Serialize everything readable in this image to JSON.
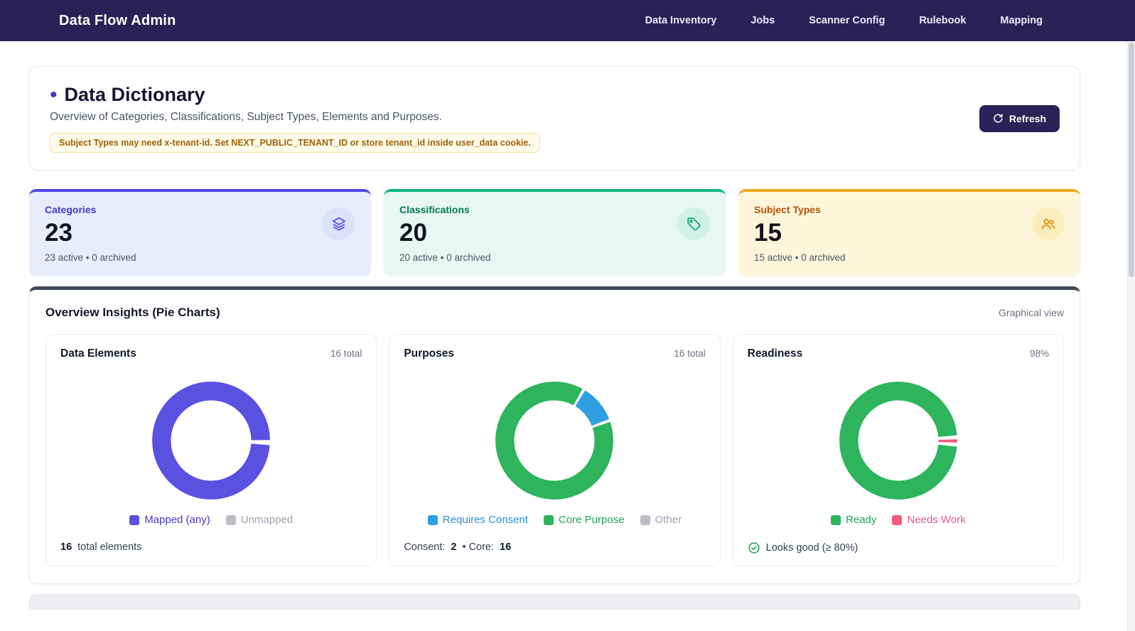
{
  "colors": {
    "navbar_bg": "#2a2156",
    "accent_indigo": "#4f46e5",
    "accent_teal": "#10b981",
    "accent_amber": "#f0a820",
    "insights_top_border": "#414a57",
    "notice_text": "#a16207",
    "refresh_button_bg": "#2a2357"
  },
  "navbar": {
    "brand": "Data Flow Admin",
    "items": [
      {
        "label": "Data Inventory"
      },
      {
        "label": "Jobs"
      },
      {
        "label": "Scanner Config"
      },
      {
        "label": "Rulebook"
      },
      {
        "label": "Mapping"
      }
    ]
  },
  "header": {
    "bullet": "•",
    "title": "Data Dictionary",
    "subtitle": "Overview of Categories, Classifications, Subject Types, Elements and Purposes.",
    "notice": "Subject Types may need x-tenant-id. Set NEXT_PUBLIC_TENANT_ID or store tenant_id inside user_data cookie.",
    "refresh_label": "Refresh"
  },
  "stats": [
    {
      "title": "Categories",
      "value": "23",
      "detail": "23 active • 0 archived",
      "icon": "layers-icon"
    },
    {
      "title": "Classifications",
      "value": "20",
      "detail": "20 active • 0 archived",
      "icon": "tag-icon"
    },
    {
      "title": "Subject Types",
      "value": "15",
      "detail": "15 active • 0 archived",
      "icon": "users-icon"
    }
  ],
  "insights": {
    "title": "Overview Insights (Pie Charts)",
    "view_label": "Graphical view"
  },
  "chart_data": [
    {
      "type": "pie",
      "title": "Data Elements",
      "total_label": "16 total",
      "segments": [
        {
          "label": "Mapped (any)",
          "value": 16,
          "color": "#5b51e1"
        },
        {
          "label": "Unmapped",
          "value": 0,
          "color": "#c7cbd4"
        }
      ],
      "legend": [
        {
          "label": "Mapped (any)",
          "swatch": "#5b51e1",
          "text_color": "#4338ca"
        },
        {
          "label": "Unmapped",
          "swatch": "#b9bec7",
          "text_color": "#9ca3af"
        }
      ],
      "footer": [
        {
          "text": "16",
          "bold": true
        },
        {
          "text": " total elements"
        }
      ],
      "layout": {
        "rotation": 92,
        "pad": 5,
        "legend_position": "bottom"
      }
    },
    {
      "type": "pie",
      "title": "Purposes",
      "total_label": "16 total",
      "segments": [
        {
          "label": "Requires Consent",
          "value": 2,
          "color": "#2d9fe0"
        },
        {
          "label": "Core Purpose",
          "value": 16,
          "color": "#2db45c"
        },
        {
          "label": "Other",
          "value": 0,
          "color": "#c7cbd4"
        }
      ],
      "legend": [
        {
          "label": "Requires Consent",
          "swatch": "#2d9fe0",
          "text_color": "#2b8fd8"
        },
        {
          "label": "Core Purpose",
          "swatch": "#2db45c",
          "text_color": "#23a455"
        },
        {
          "label": "Other",
          "swatch": "#b9bec7",
          "text_color": "#9ca3af"
        }
      ],
      "footer": [
        {
          "text": "Consent: "
        },
        {
          "text": "2",
          "bold": true
        },
        {
          "text": " • Core: "
        },
        {
          "text": "16",
          "bold": true
        }
      ],
      "layout": {
        "rotation": 30,
        "pad": 3,
        "legend_position": "bottom"
      }
    },
    {
      "type": "pie",
      "title": "Readiness",
      "total_label": "98%",
      "segments": [
        {
          "label": "Ready",
          "value": 98,
          "color": "#2db45c"
        },
        {
          "label": "Needs Work",
          "value": 2,
          "color": "#f25c7d"
        }
      ],
      "legend": [
        {
          "label": "Ready",
          "swatch": "#2db45c",
          "text_color": "#23a455"
        },
        {
          "label": "Needs Work",
          "swatch": "#f25c7d",
          "text_color": "#f0597c"
        }
      ],
      "footer_icon": "check-circle-icon",
      "footer": [
        {
          "text": "Looks good (≥ 80%)"
        }
      ],
      "layout": {
        "rotation": 94,
        "pad": 4,
        "legend_position": "bottom"
      }
    }
  ]
}
